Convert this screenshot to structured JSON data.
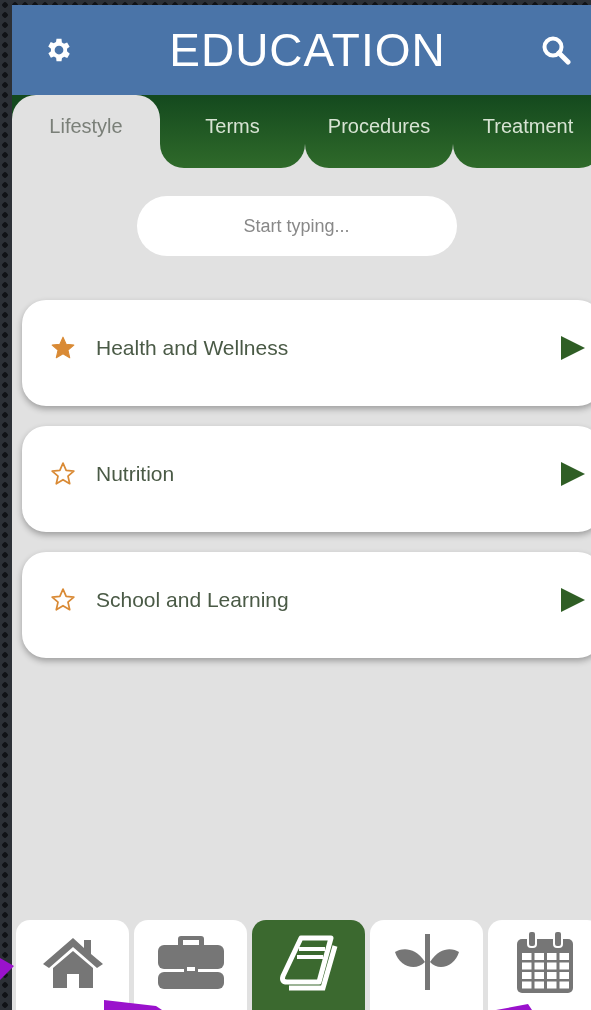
{
  "header": {
    "title": "EDUCATION"
  },
  "tabs": [
    {
      "label": "Lifestyle",
      "selected": true
    },
    {
      "label": "Terms",
      "selected": false
    },
    {
      "label": "Procedures",
      "selected": false
    },
    {
      "label": "Treatment",
      "selected": false
    }
  ],
  "search": {
    "placeholder": "Start typing..."
  },
  "topics": [
    {
      "label": "Health and Wellness",
      "favorite": true
    },
    {
      "label": "Nutrition",
      "favorite": false
    },
    {
      "label": "School and Learning",
      "favorite": false
    }
  ],
  "bottom_nav": [
    {
      "kind": "home",
      "selected": false
    },
    {
      "kind": "briefcase",
      "selected": false
    },
    {
      "kind": "book",
      "selected": true
    },
    {
      "kind": "plant",
      "selected": false
    },
    {
      "kind": "calendar",
      "selected": false
    }
  ]
}
